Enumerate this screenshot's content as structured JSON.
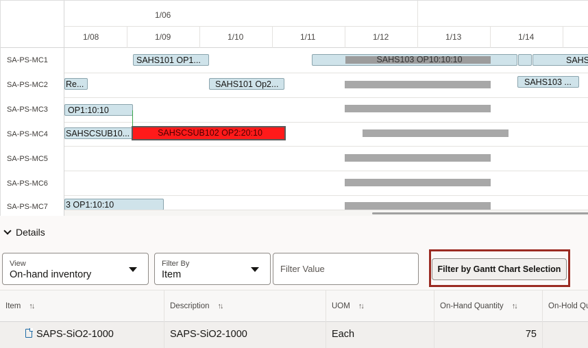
{
  "gantt": {
    "major_label": "1/06",
    "dates": [
      "1/08",
      "1/09",
      "1/10",
      "1/11",
      "1/12",
      "1/13",
      "1/14"
    ],
    "resources": [
      "SA-PS-MC1",
      "SA-PS-MC2",
      "SA-PS-MC3",
      "SA-PS-MC4",
      "SA-PS-MC5",
      "SA-PS-MC6",
      "SA-PS-MC7"
    ],
    "bars": {
      "mc1_a": "SAHS101 OP1...",
      "mc1_b": "SAHS103 OP10:10:10",
      "mc1_c": "SAHS",
      "mc2_a": "Re...",
      "mc2_b": "SAHS101 Op2...",
      "mc2_c": "SAHS103 ...",
      "mc3_a": "OP1:10:10",
      "mc4_a": "SAHSCSUB10...",
      "mc4_b": "SAHSCSUB102 OP2:20:10",
      "mc7_a": "3 OP1:10:10"
    }
  },
  "details": {
    "title": "Details",
    "view": {
      "label": "View",
      "value": "On-hand inventory"
    },
    "filter_by": {
      "label": "Filter By",
      "value": "Item"
    },
    "filter_value": {
      "placeholder": "Filter Value"
    },
    "filter_button": "Filter by Gantt Chart Selection",
    "table": {
      "columns": [
        "Item",
        "Description",
        "UOM",
        "On-Hand Quantity",
        "On-Hold Qu"
      ],
      "rows": [
        {
          "item": "SAPS-SiO2-1000",
          "description": "SAPS-SiO2-1000",
          "uom": "Each",
          "on_hand": "75"
        }
      ]
    }
  },
  "colors": {
    "highlight": "#9b2b22",
    "bar_blue": "#cfe3ea",
    "bar_red": "#ff1a1a",
    "dependency": "#3aa64a"
  }
}
